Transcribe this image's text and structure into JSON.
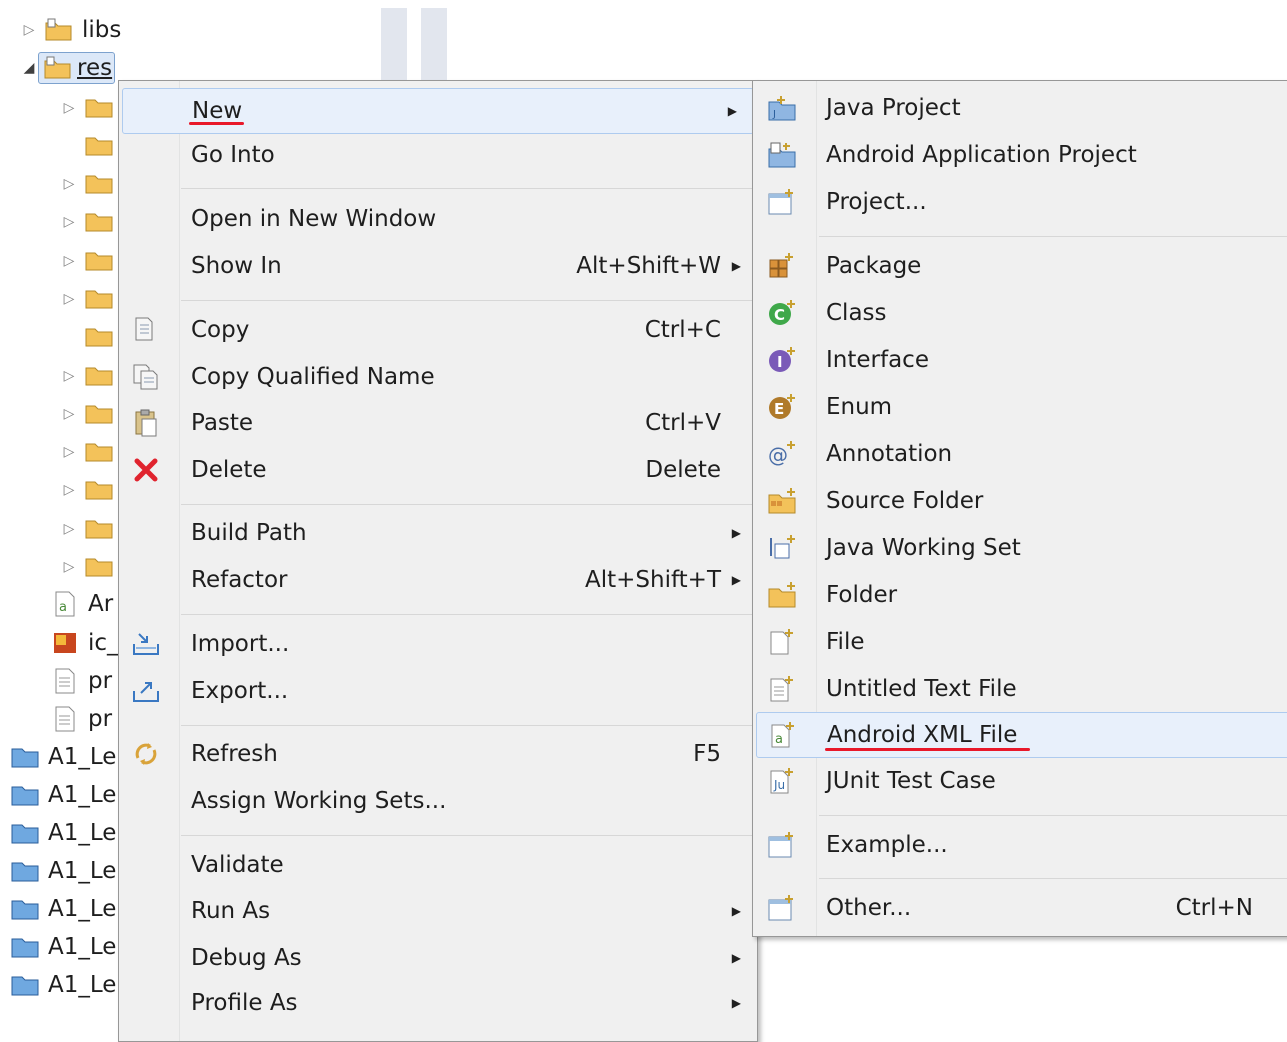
{
  "tree": {
    "items": [
      {
        "label": "libs"
      },
      {
        "label": "res"
      },
      {
        "label": "Ar"
      },
      {
        "label": "ic_"
      },
      {
        "label": "pr"
      },
      {
        "label": "pr"
      },
      {
        "label": "A1_Le"
      },
      {
        "label": "A1_Le"
      },
      {
        "label": "A1_Le"
      },
      {
        "label": "A1_Le"
      },
      {
        "label": "A1_Le"
      },
      {
        "label": "A1_Le"
      },
      {
        "label": "A1_Le"
      }
    ]
  },
  "context_menu": {
    "items": [
      {
        "label": "New",
        "shortcut": "",
        "submenu": true
      },
      {
        "label": "Go Into",
        "shortcut": "",
        "submenu": false
      },
      {
        "label": "Open in New Window",
        "shortcut": "",
        "submenu": false
      },
      {
        "label": "Show In",
        "shortcut": "Alt+Shift+W",
        "submenu": true
      },
      {
        "label": "Copy",
        "shortcut": "Ctrl+C",
        "icon": "copy-icon"
      },
      {
        "label": "Copy Qualified Name",
        "shortcut": "",
        "icon": "copy-qualified-icon"
      },
      {
        "label": "Paste",
        "shortcut": "Ctrl+V",
        "icon": "paste-icon"
      },
      {
        "label": "Delete",
        "shortcut": "Delete",
        "icon": "delete-icon"
      },
      {
        "label": "Build Path",
        "shortcut": "",
        "submenu": true
      },
      {
        "label": "Refactor",
        "shortcut": "Alt+Shift+T",
        "submenu": true
      },
      {
        "label": "Import...",
        "shortcut": "",
        "icon": "import-icon"
      },
      {
        "label": "Export...",
        "shortcut": "",
        "icon": "export-icon"
      },
      {
        "label": "Refresh",
        "shortcut": "F5",
        "icon": "refresh-icon"
      },
      {
        "label": "Assign Working Sets...",
        "shortcut": ""
      },
      {
        "label": "Validate",
        "shortcut": ""
      },
      {
        "label": "Run As",
        "shortcut": "",
        "submenu": true
      },
      {
        "label": "Debug As",
        "shortcut": "",
        "submenu": true
      },
      {
        "label": "Profile As",
        "shortcut": "",
        "submenu": true
      }
    ]
  },
  "new_submenu": {
    "items": [
      {
        "label": "Java Project",
        "icon": "java-project-icon"
      },
      {
        "label": "Android Application Project",
        "icon": "android-project-icon"
      },
      {
        "label": "Project...",
        "icon": "project-icon"
      },
      {
        "label": "Package",
        "icon": "package-icon"
      },
      {
        "label": "Class",
        "icon": "class-icon"
      },
      {
        "label": "Interface",
        "icon": "interface-icon"
      },
      {
        "label": "Enum",
        "icon": "enum-icon"
      },
      {
        "label": "Annotation",
        "icon": "annotation-icon"
      },
      {
        "label": "Source Folder",
        "icon": "source-folder-icon"
      },
      {
        "label": "Java Working Set",
        "icon": "working-set-icon"
      },
      {
        "label": "Folder",
        "icon": "folder-icon"
      },
      {
        "label": "File",
        "icon": "file-icon"
      },
      {
        "label": "Untitled Text File",
        "icon": "text-file-icon"
      },
      {
        "label": "Android XML File",
        "icon": "android-xml-icon"
      },
      {
        "label": "JUnit Test Case",
        "icon": "junit-icon"
      },
      {
        "label": "Example...",
        "icon": "example-icon"
      },
      {
        "label": "Other...",
        "shortcut": "Ctrl+N",
        "icon": "other-icon"
      }
    ]
  },
  "colors": {
    "menu_bg": "#f0f0f0",
    "hover_bg": "#e8f0fb",
    "hover_border": "#aecbef",
    "annotation_red": "#e8182a"
  }
}
